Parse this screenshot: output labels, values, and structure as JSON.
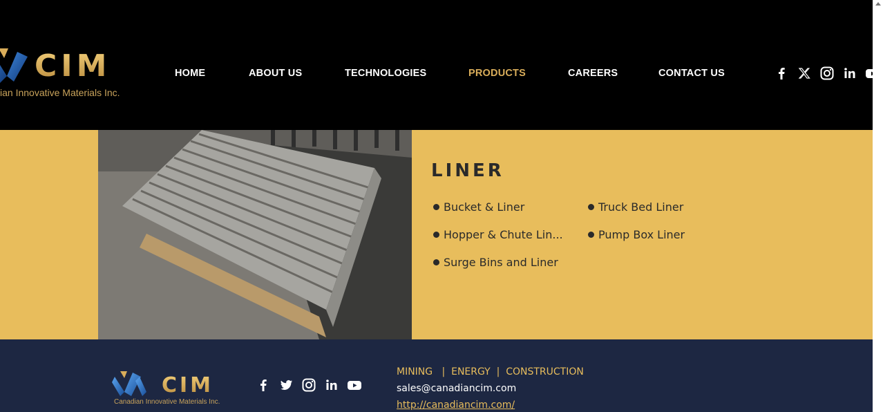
{
  "header": {
    "logo_text": "CIM",
    "logo_tagline": "ian Innovative Materials Inc."
  },
  "nav": {
    "items": [
      {
        "label": "HOME"
      },
      {
        "label": "ABOUT US"
      },
      {
        "label": "TECHNOLOGIES"
      },
      {
        "label": "PRODUCTS",
        "active": true
      },
      {
        "label": "CAREERS"
      },
      {
        "label": "CONTACT US"
      }
    ]
  },
  "social": [
    "facebook-icon",
    "x-icon",
    "instagram-icon",
    "linkedin-icon",
    "youtube-icon"
  ],
  "product": {
    "title": "LINER",
    "items": [
      "Bucket & Liner",
      "Truck Bed Liner",
      "Hopper & Chute Lin...",
      "Pump Box Liner",
      "Surge Bins and Liner"
    ]
  },
  "footer": {
    "logo_text": "CIM",
    "logo_tagline": "Canadian Innovative Materials Inc.",
    "sectors": "MINING   |  ENERGY  |  CONSTRUCTION",
    "email": "sales@canadiancim.com",
    "url": "http://canadiancim.com/"
  },
  "colors": {
    "header_bg": "#000000",
    "accent_gold": "#e8bd5c",
    "nav_active": "#d9ad5a",
    "footer_bg": "#1d2742",
    "text_dark": "#2a2a2a"
  }
}
